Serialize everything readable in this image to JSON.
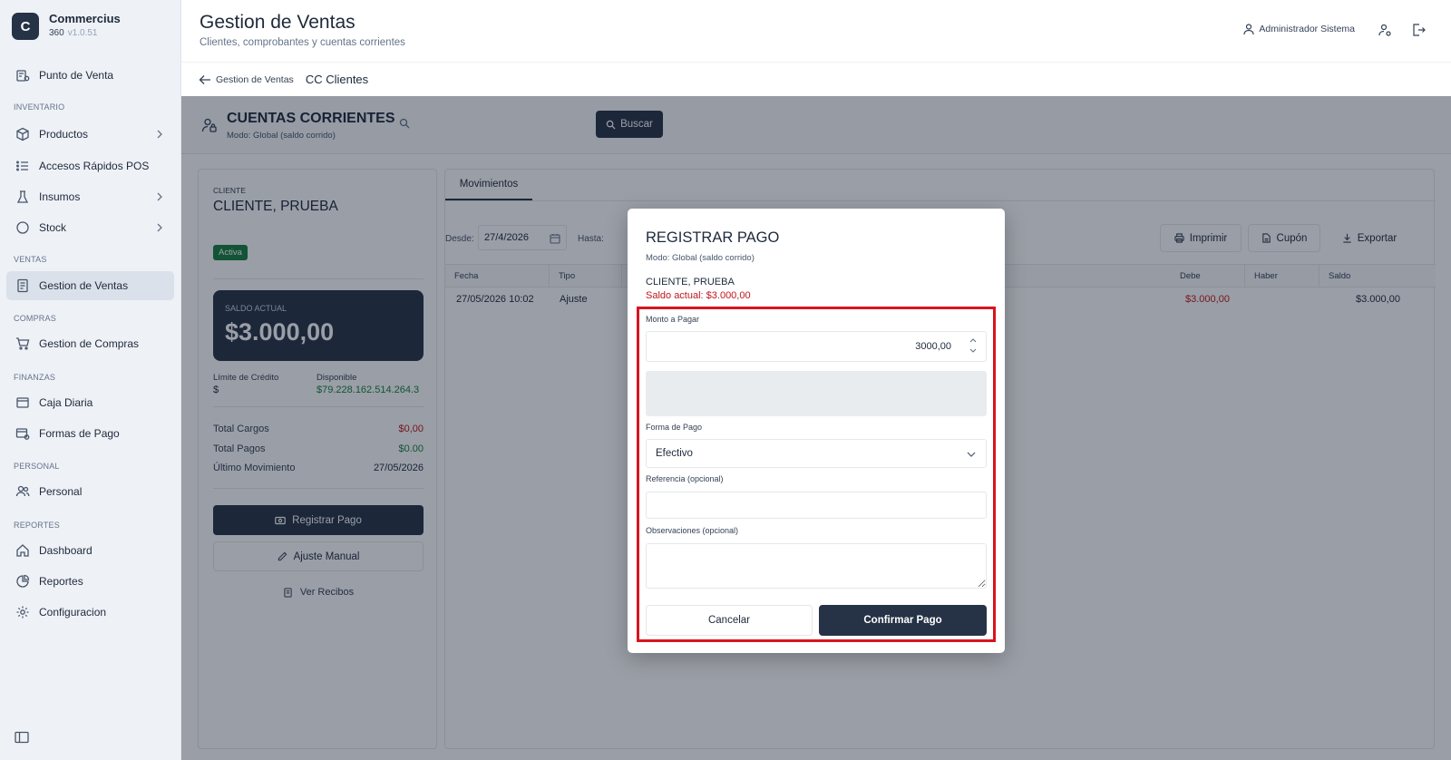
{
  "sidebar": {
    "brand_letter": "C",
    "brand_name": "Commercius",
    "brand_sub": "360",
    "brand_version": "v1.0.51",
    "items": {
      "punto_venta": "Punto de Venta",
      "productos": "Productos",
      "accesos": "Accesos Rápidos POS",
      "insumos": "Insumos",
      "stock": "Stock",
      "gestion_ventas": "Gestion de Ventas",
      "gestion_compras": "Gestion de Compras",
      "caja": "Caja Diaria",
      "formas_pago": "Formas de Pago",
      "personal": "Personal",
      "dashboard": "Dashboard",
      "reportes": "Reportes",
      "configuracion": "Configuracion"
    },
    "sections": {
      "inventario": "INVENTARIO",
      "ventas": "VENTAS",
      "compras": "COMPRAS",
      "finanzas": "FINANZAS",
      "personal": "PERSONAL",
      "reportes": "REPORTES"
    }
  },
  "header": {
    "title": "Gestion de Ventas",
    "subtitle": "Clientes, comprobantes y cuentas corrientes",
    "user": "Administrador Sistema"
  },
  "breadcrumb": {
    "parent": "Gestion de Ventas",
    "current": "CC Clientes"
  },
  "accounts": {
    "title": "CUENTAS CORRIENTES",
    "mode": "Modo: Global (saldo corrido)",
    "search_placeholder": "",
    "search_button": "Buscar"
  },
  "client": {
    "label": "CLIENTE",
    "name": "CLIENTE, PRUEBA",
    "status": "Activa",
    "saldo_label": "SALDO ACTUAL",
    "saldo_value": "$3.000,00",
    "credit_limit_label": "Límite de Crédito",
    "credit_limit_value": "$",
    "available_label": "Disponible",
    "available_value": "$79.228.162.514.264.3",
    "total_cargos_label": "Total Cargos",
    "total_cargos_value": "$0,00",
    "total_pagos_label": "Total Pagos",
    "total_pagos_value": "$0.00",
    "last_move_label": "Último Movimiento",
    "last_move_value": "27/05/2026",
    "register_payment": "Registrar Pago",
    "manual_adjust": "Ajuste Manual",
    "view_receipts": "Ver Recibos"
  },
  "movements": {
    "tab": "Movimientos",
    "from_label": "Desde:",
    "from_value": "27/4/2026",
    "to_label": "Hasta:",
    "print": "Imprimir",
    "coupon": "Cupón",
    "export": "Exportar",
    "columns": {
      "fecha": "Fecha",
      "tipo": "Tipo",
      "debe": "Debe",
      "haber": "Haber",
      "saldo": "Saldo"
    },
    "rows": [
      {
        "fecha": "27/05/2026 10:02",
        "tipo": "Ajuste",
        "debe": "$3.000,00",
        "haber": "",
        "saldo": "$3.000,00"
      }
    ]
  },
  "modal": {
    "title": "REGISTRAR PAGO",
    "mode": "Modo: Global (saldo corrido)",
    "client": "CLIENTE, PRUEBA",
    "saldo": "Saldo actual: $3.000,00",
    "amount_label": "Monto a Pagar",
    "amount_value": "3000,00",
    "payment_method_label": "Forma de Pago",
    "payment_method_value": "Efectivo",
    "reference_label": "Referencia (opcional)",
    "notes_label": "Observaciones (opcional)",
    "cancel": "Cancelar",
    "confirm": "Confirmar Pago"
  },
  "colors": {
    "primary_dark": "#263246",
    "negative_red": "#c0161b",
    "positive_green": "#15803d",
    "highlight_red": "#d7141f"
  }
}
